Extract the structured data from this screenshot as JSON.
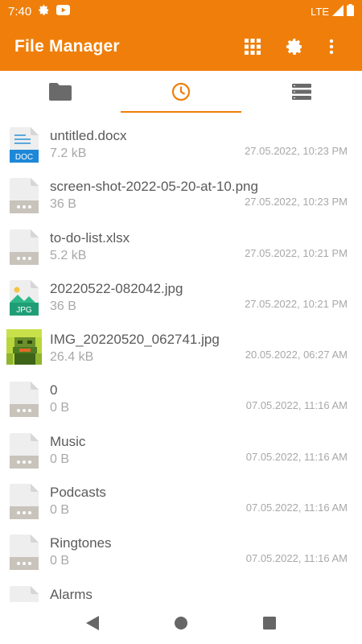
{
  "status_bar": {
    "time": "7:40",
    "network": "LTE",
    "icons": [
      "gear-icon",
      "youtube-icon",
      "signal-icon",
      "battery-icon"
    ]
  },
  "app_bar": {
    "title": "File Manager",
    "actions": [
      "grid-view-icon",
      "settings-icon",
      "more-vert-icon"
    ]
  },
  "tabs": [
    {
      "icon": "folder-icon",
      "active": false
    },
    {
      "icon": "recent-clock-icon",
      "active": true
    },
    {
      "icon": "storage-list-icon",
      "active": false
    }
  ],
  "colors": {
    "accent": "#ef7f0a",
    "text_primary": "#5a5a5a",
    "text_secondary": "#a8a8a8"
  },
  "files": [
    {
      "name": "untitled.docx",
      "size": "7.2 kB",
      "date": "27.05.2022, 10:23 PM",
      "icon": "doc"
    },
    {
      "name": "screen-shot-2022-05-20-at-10.png",
      "size": "36 B",
      "date": "27.05.2022, 10:23 PM",
      "icon": "generic"
    },
    {
      "name": "to-do-list.xlsx",
      "size": "5.2 kB",
      "date": "27.05.2022, 10:21 PM",
      "icon": "generic"
    },
    {
      "name": "20220522-082042.jpg",
      "size": "36 B",
      "date": "27.05.2022, 10:21 PM",
      "icon": "jpg"
    },
    {
      "name": "IMG_20220520_062741.jpg",
      "size": "26.4 kB",
      "date": "20.05.2022, 06:27 AM",
      "icon": "thumb"
    },
    {
      "name": "0",
      "size": "0 B",
      "date": "07.05.2022, 11:16 AM",
      "icon": "generic"
    },
    {
      "name": "Music",
      "size": "0 B",
      "date": "07.05.2022, 11:16 AM",
      "icon": "generic"
    },
    {
      "name": "Podcasts",
      "size": "0 B",
      "date": "07.05.2022, 11:16 AM",
      "icon": "generic"
    },
    {
      "name": "Ringtones",
      "size": "0 B",
      "date": "07.05.2022, 11:16 AM",
      "icon": "generic"
    },
    {
      "name": "Alarms",
      "size": "",
      "date": "",
      "icon": "generic"
    }
  ],
  "icon_labels": {
    "doc": "DOC",
    "jpg": "JPG"
  },
  "nav": [
    "back-icon",
    "home-icon",
    "recents-icon"
  ]
}
